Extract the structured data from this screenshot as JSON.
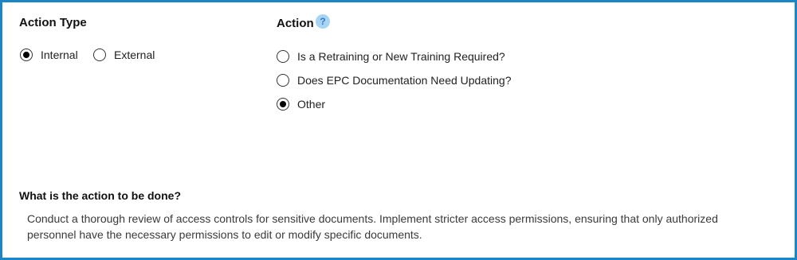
{
  "action_type": {
    "title": "Action Type",
    "options": [
      {
        "label": "Internal",
        "selected": true
      },
      {
        "label": "External",
        "selected": false
      }
    ]
  },
  "action": {
    "title": "Action",
    "help_icon": "?",
    "options": [
      {
        "label": "Is a Retraining or New Training Required?",
        "selected": false
      },
      {
        "label": "Does EPC Documentation Need Updating?",
        "selected": false
      },
      {
        "label": "Other",
        "selected": true
      }
    ]
  },
  "details": {
    "question": "What is the action to be done?",
    "answer": "Conduct a thorough review of access controls for sensitive documents. Implement stricter access permissions, ensuring that only authorized personnel have the necessary permissions to edit or modify specific documents."
  },
  "colors": {
    "border": "#1a86c8",
    "help_bg": "#a7d3f5",
    "help_fg": "#2f7fc4"
  }
}
